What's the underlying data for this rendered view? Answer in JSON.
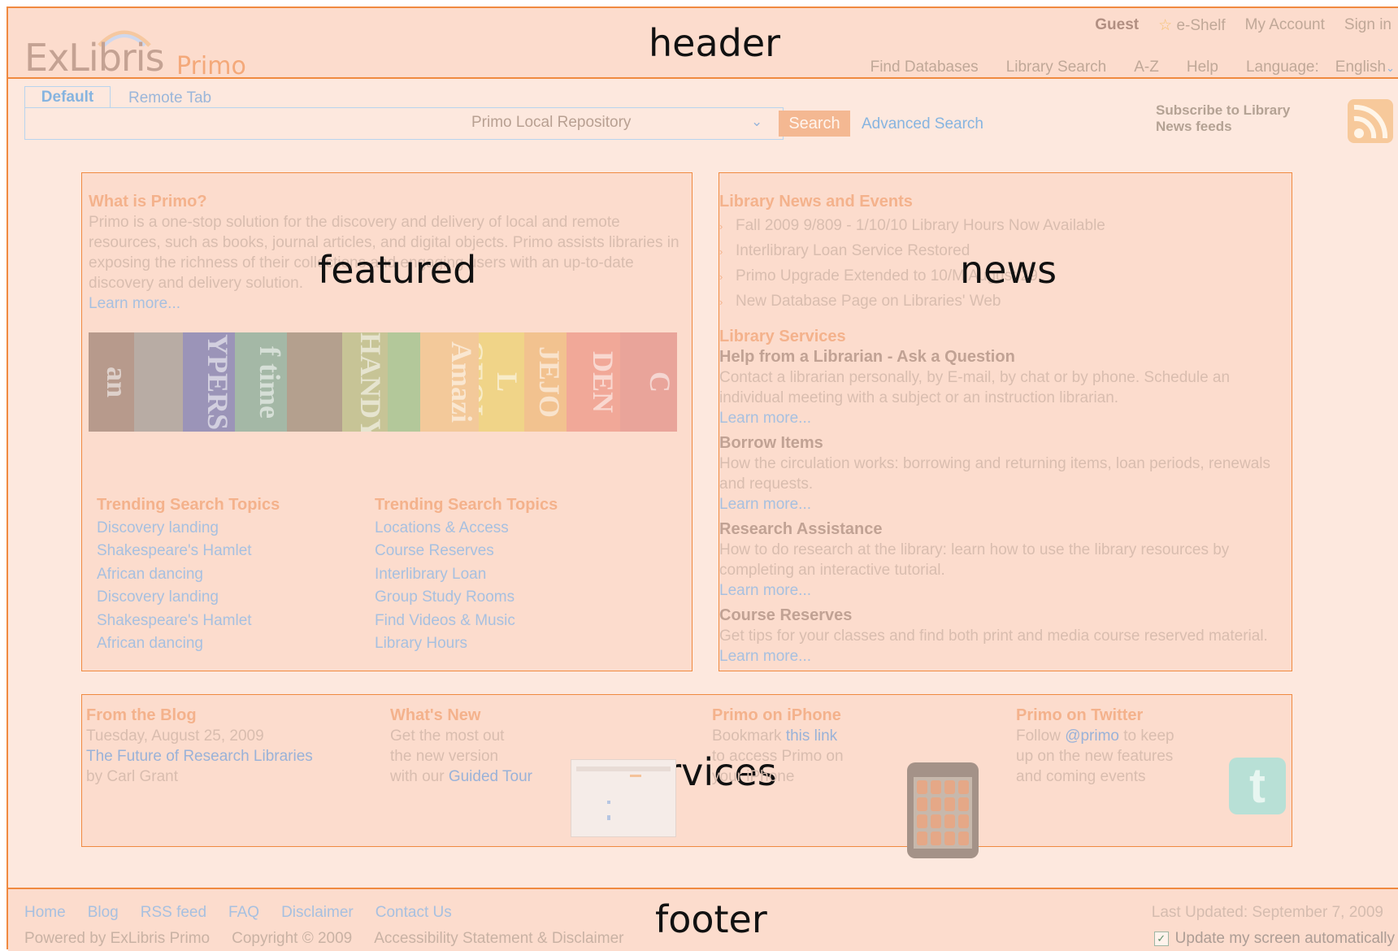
{
  "labels": {
    "header": "header",
    "featured": "featured",
    "news": "news",
    "services": "services",
    "footer": "footer"
  },
  "header": {
    "logo_exlibris": "ExLibris",
    "logo_primo": "Primo",
    "top_links": [
      "Guest",
      "e-Shelf",
      "My Account",
      "Sign in"
    ],
    "nav_links": [
      "Find Databases",
      "Library Search",
      "A-Z",
      "Help",
      "Language:",
      "English"
    ]
  },
  "search": {
    "tabs": [
      "Default",
      "Remote Tab"
    ],
    "scope": "Primo Local Repository",
    "button": "Search",
    "advanced": "Advanced Search",
    "subscribe": "Subscribe to Library News feeds"
  },
  "featured": {
    "title": "What is Primo?",
    "body": "Primo is a one-stop solution for the discovery and delivery of local and remote resources, such as books, journal articles, and digital objects. Primo assists libraries in exposing the richness of their collections and engaging users with an up-to-date discovery and delivery solution.",
    "learn": "Learn more...",
    "book_spines": [
      "an",
      "YPERS",
      "f time",
      "HANDY",
      "Amazi",
      "L GEOL",
      "JEJO",
      "DEN",
      "C"
    ],
    "trending_left": {
      "title": "Trending Search Topics",
      "items": [
        "Discovery landing",
        "Shakespeare's Hamlet",
        "African dancing",
        "Discovery landing",
        "Shakespeare's Hamlet",
        "African dancing"
      ]
    },
    "trending_right": {
      "title": "Trending Search Topics",
      "items": [
        "Locations & Access",
        "Course Reserves",
        "Interlibrary Loan",
        "Group Study Rooms",
        "Find Videos & Music",
        "Library Hours"
      ]
    }
  },
  "news": {
    "title": "Library News and Events",
    "items": [
      "Fall 2009 9/809 - 1/10/10 Library Hours Now Available",
      "Interlibrary Loan Service Restored",
      "Primo Upgrade Extended to 10/M August 29",
      "New Database Page on Libraries' Web"
    ],
    "services_title": "Library Services",
    "services": [
      {
        "head": "Help from a Librarian - Ask a Question",
        "desc": "Contact a librarian personally, by E-mail, by chat or by phone. Schedule an individual meeting with a subject or an instruction librarian.",
        "learn": "Learn more..."
      },
      {
        "head": "Borrow Items",
        "desc": "How the circulation works: borrowing and returning items, loan periods, renewals and requests.",
        "learn": "Learn more..."
      },
      {
        "head": "Research Assistance",
        "desc": "How to do research at the library: learn how to use the library resources by completing an interactive tutorial.",
        "learn": "Learn more..."
      },
      {
        "head": "Course Reserves",
        "desc": "Get tips for your classes and find both print and media course reserved material.",
        "learn": "Learn more..."
      }
    ]
  },
  "services": {
    "blog": {
      "title": "From the Blog",
      "date": "Tuesday, August 25, 2009",
      "link": "The Future of Research Libraries",
      "by": "by Carl Grant"
    },
    "whats_new": {
      "title": "What's New",
      "line1": "Get the most out",
      "line2": "the new version",
      "line3_prefix": "with our",
      "line3_link": "Guided Tour"
    },
    "iphone": {
      "title": "Primo on iPhone",
      "line1_prefix": "Bookmark",
      "line1_link": "this link",
      "line2": "to access Primo on",
      "line3": "your iPhone"
    },
    "twitter": {
      "title": "Primo on Twitter",
      "line1_prefix": "Follow",
      "line1_link": "@primo",
      "line1_suffix": "to keep",
      "line2": "up on the new features",
      "line3": "and coming events"
    }
  },
  "footer": {
    "links": [
      "Home",
      "Blog",
      "RSS feed",
      "FAQ",
      "Disclaimer",
      "Contact Us"
    ],
    "info": [
      "Powered by ExLibris Primo",
      "Copyright © 2009",
      "Accessibility Statement & Disclaimer"
    ],
    "updated": "Last Updated: September 7, 2009",
    "auto_update": "Update my screen automatically"
  }
}
